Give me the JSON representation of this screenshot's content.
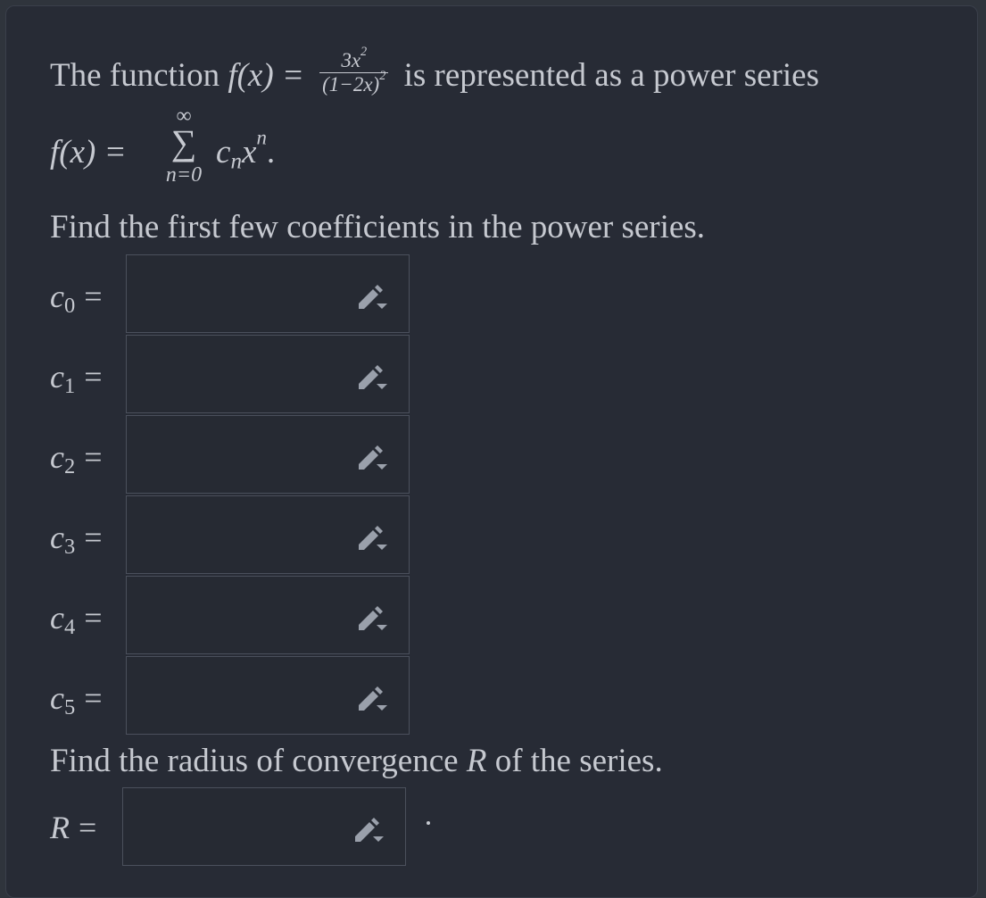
{
  "problem": {
    "intro_prefix": "The function",
    "func_lhs": "f(x) =",
    "frac_num": "3x",
    "frac_num_exp": "2",
    "frac_den": "(1−2x)",
    "frac_den_exp": "2",
    "intro_suffix": "is represented as a power series",
    "series_lhs": "f(x) =",
    "sum_upper": "∞",
    "sum_symbol": "∑",
    "sum_lower": "n=0",
    "series_term": "c",
    "series_sub": "n",
    "series_x": "x",
    "series_exp": "n",
    "series_end": ".",
    "find_coeffs": "Find the first few coefficients in the power series.",
    "find_radius_prefix": "Find the radius of convergence",
    "find_radius_var": "R",
    "find_radius_suffix": "of the series."
  },
  "coefficients": [
    {
      "var": "c",
      "sub": "0",
      "eq": "=",
      "value": ""
    },
    {
      "var": "c",
      "sub": "1",
      "eq": "=",
      "value": ""
    },
    {
      "var": "c",
      "sub": "2",
      "eq": "=",
      "value": ""
    },
    {
      "var": "c",
      "sub": "3",
      "eq": "=",
      "value": ""
    },
    {
      "var": "c",
      "sub": "4",
      "eq": "=",
      "value": ""
    },
    {
      "var": "c",
      "sub": "5",
      "eq": "=",
      "value": ""
    }
  ],
  "radius": {
    "var": "R",
    "eq": "=",
    "value": ""
  },
  "icons": {
    "edit": "pencil-dropdown-icon"
  },
  "colors": {
    "background": "#272b35",
    "text": "#c6c9d0",
    "input_border": "#4b505c",
    "icon": "#9aa0ab"
  }
}
